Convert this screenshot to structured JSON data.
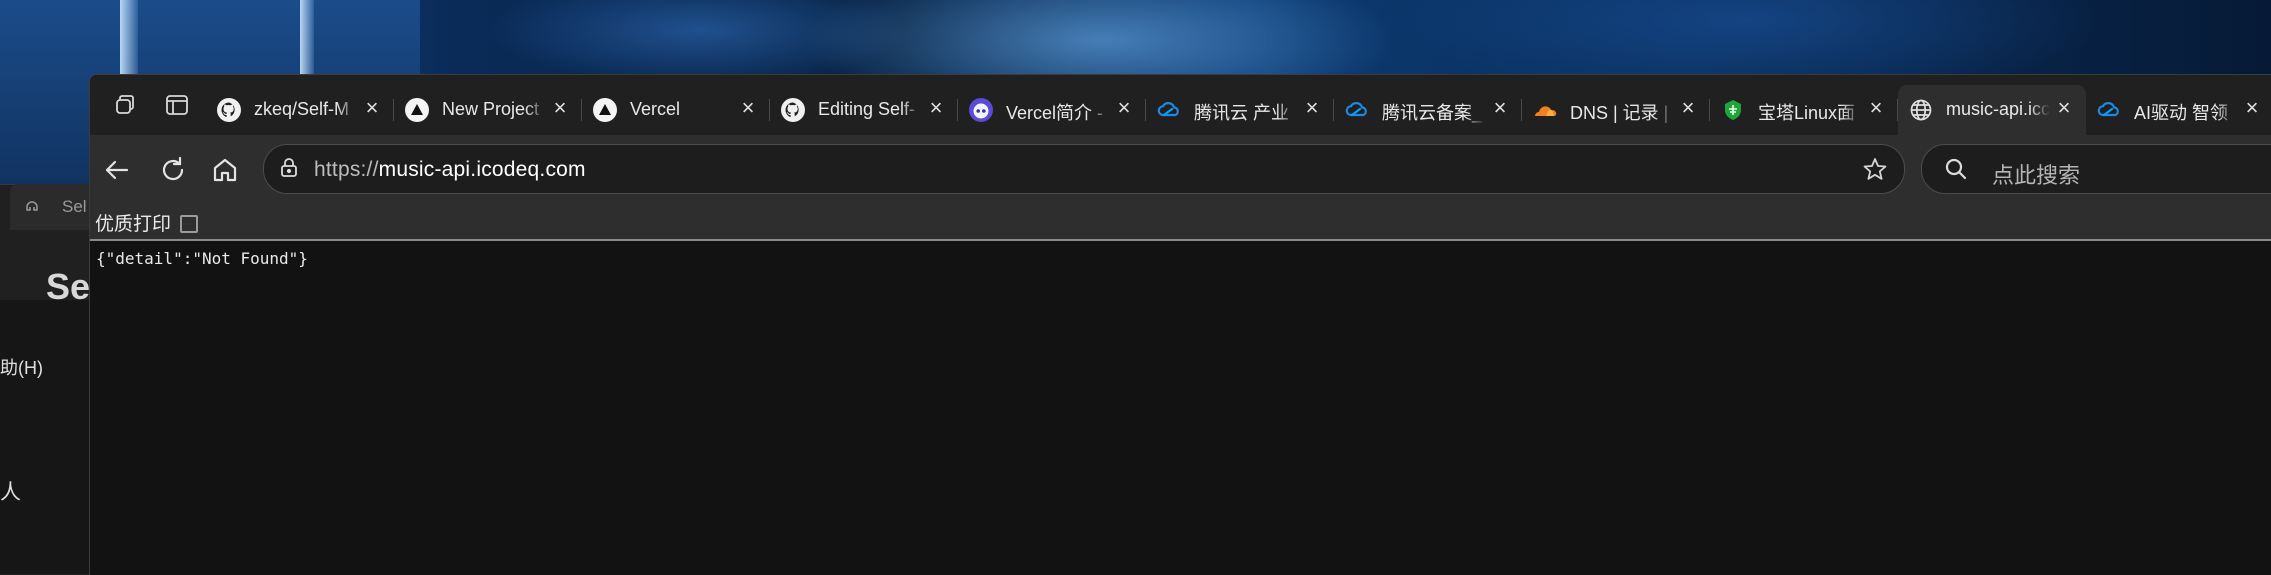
{
  "desktop": {
    "back_window_tab_title": "Sel",
    "back_window_heading": "Se",
    "back_window_menu": "助(H)",
    "back_window_text": "人"
  },
  "browser": {
    "tabs": [
      {
        "label": "zkeq/Self-M",
        "icon": "github-icon",
        "active": false
      },
      {
        "label": "New Project",
        "icon": "vercel-icon",
        "active": false
      },
      {
        "label": "Vercel",
        "icon": "vercel-icon",
        "active": false
      },
      {
        "label": "Editing Self-",
        "icon": "github-icon",
        "active": false
      },
      {
        "label": "Vercel简介 -",
        "icon": "bot-icon",
        "active": false
      },
      {
        "label": "腾讯云 产业",
        "icon": "tencent-cloud-icon",
        "active": false
      },
      {
        "label": "腾讯云备案_",
        "icon": "tencent-cloud-icon",
        "active": false
      },
      {
        "label": "DNS | 记录 |",
        "icon": "cloudflare-icon",
        "active": false
      },
      {
        "label": "宝塔Linux面",
        "icon": "baota-icon",
        "active": false
      },
      {
        "label": "music-api.icc",
        "icon": "globe-icon",
        "active": true
      },
      {
        "label": "AI驱动 智领",
        "icon": "tencent-cloud-icon",
        "active": false
      }
    ],
    "address_bar": {
      "scheme": "https://",
      "domain": "music-api.icodeq.com"
    },
    "search": {
      "placeholder": "点此搜索"
    },
    "bookmarks": {
      "first_label": "优质打印"
    },
    "page_body": "{\"detail\":\"Not Found\"}"
  },
  "colors": {
    "tabstrip_bg": "#202020",
    "toolbar_bg": "#2e2e2e",
    "page_bg": "#121212",
    "tencent_blue": "#1e88e5",
    "cloudflare_orange": "#f38020",
    "baota_green": "#20a53a"
  }
}
